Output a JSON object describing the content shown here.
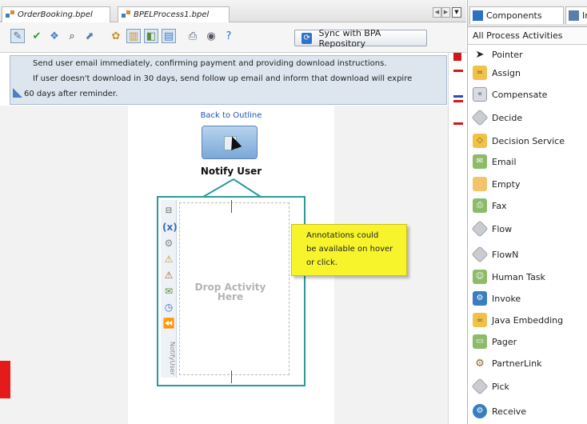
{
  "editor": {
    "tabs": [
      {
        "label": "OrderBooking.bpel"
      },
      {
        "label": "BPELProcess1.bpel"
      }
    ],
    "toolbar": {
      "sync_label": "Sync with BPA Repository"
    },
    "description": {
      "line1": "Send user email immediately, confirming payment and providing download instructions.",
      "line2": "If user doesn't download in 30 days, send follow up email and inform that download will expire",
      "line3": "60 days after reminder."
    },
    "canvas": {
      "back_link": "Back to Outline",
      "activity_label": "Notify User",
      "scope_vertical_label": "NotifyUser",
      "drop_line1": "Drop Activity",
      "drop_line2": "Here",
      "note_lines": [
        "Annotations could",
        "be available on hover",
        "or click."
      ]
    }
  },
  "palette": {
    "tabs": [
      {
        "label": "Components"
      },
      {
        "label": "In"
      }
    ],
    "category": "All Process Activities",
    "items": [
      {
        "label": "Pointer",
        "icon": "pointer-icon",
        "color": "#ffffff"
      },
      {
        "label": "Assign",
        "icon": "assign-icon",
        "color": "#f0c24a"
      },
      {
        "label": "Compensate",
        "icon": "compensate-icon",
        "color": "#d8dde4"
      },
      {
        "label": "Decide",
        "icon": "decide-icon",
        "color": "#c9ccd1"
      },
      {
        "label": "Decision Service",
        "icon": "decision-service-icon",
        "color": "#f0c24a"
      },
      {
        "label": "Email",
        "icon": "email-icon",
        "color": "#8dbb6a"
      },
      {
        "label": "Empty",
        "icon": "empty-icon",
        "color": "#f4c46a"
      },
      {
        "label": "Fax",
        "icon": "fax-icon",
        "color": "#8dbb6a"
      },
      {
        "label": "Flow",
        "icon": "flow-icon",
        "color": "#c9ccd1"
      },
      {
        "label": "FlowN",
        "icon": "flown-icon",
        "color": "#c9ccd1"
      },
      {
        "label": "Human Task",
        "icon": "human-task-icon",
        "color": "#8dbb6a"
      },
      {
        "label": "Invoke",
        "icon": "invoke-icon",
        "color": "#3a7ec0"
      },
      {
        "label": "Java Embedding",
        "icon": "java-embedding-icon",
        "color": "#f0c24a"
      },
      {
        "label": "Pager",
        "icon": "pager-icon",
        "color": "#8dbb6a"
      },
      {
        "label": "PartnerLink",
        "icon": "partnerlink-icon",
        "color": "#d8dde4"
      },
      {
        "label": "Pick",
        "icon": "pick-icon",
        "color": "#c9ccd1"
      },
      {
        "label": "Receive",
        "icon": "receive-icon",
        "color": "#3a7ec0"
      }
    ]
  },
  "colors": {
    "accent_teal": "#2c9a9a",
    "note_yellow": "#f7f42c",
    "link_blue": "#2255aa",
    "marker_red": "#d01818"
  }
}
